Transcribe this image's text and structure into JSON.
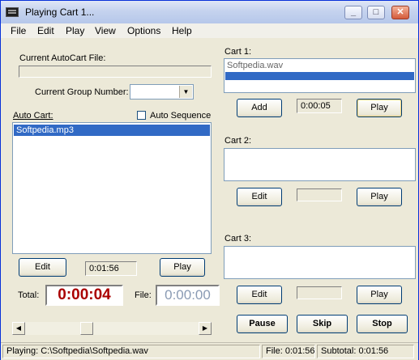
{
  "window": {
    "title": "Playing Cart 1...",
    "min": "_",
    "max": "□",
    "close": "✕"
  },
  "menu": [
    "File",
    "Edit",
    "Play",
    "View",
    "Options",
    "Help"
  ],
  "left": {
    "autocart_file_label": "Current AutoCart File:",
    "autocart_file_value": "",
    "group_label": "Current Group Number:",
    "group_value": "",
    "autocart_label": "Auto Cart:",
    "auto_sequence_label": "Auto Sequence",
    "auto_sequence_checked": false,
    "list_items": [
      "Softpedia.mp3"
    ],
    "edit_label": "Edit",
    "time_value": "0:01:56",
    "play_label": "Play",
    "total_label": "Total:",
    "total_value": "0:00:04",
    "file_label": "File:",
    "file_value": "0:00:00"
  },
  "carts": [
    {
      "label": "Cart 1:",
      "items": [
        "Softpedia.wav",
        ""
      ],
      "action_label": "Add",
      "time": "0:00:05",
      "play_label": "Play"
    },
    {
      "label": "Cart 2:",
      "items": [],
      "action_label": "Edit",
      "time": "",
      "play_label": "Play"
    },
    {
      "label": "Cart 3:",
      "items": [],
      "action_label": "Edit",
      "time": "",
      "play_label": "Play"
    }
  ],
  "controls": {
    "pause": "Pause",
    "skip": "Skip",
    "stop": "Stop"
  },
  "status": {
    "playing": "Playing: C:\\Softpedia\\Softpedia.wav",
    "file": "File: 0:01:56",
    "subtotal": "Subtotal: 0:01:56"
  },
  "colors": {
    "total_time": "#aa0000",
    "file_time": "#8a9bb4",
    "selection": "#316ac5"
  }
}
